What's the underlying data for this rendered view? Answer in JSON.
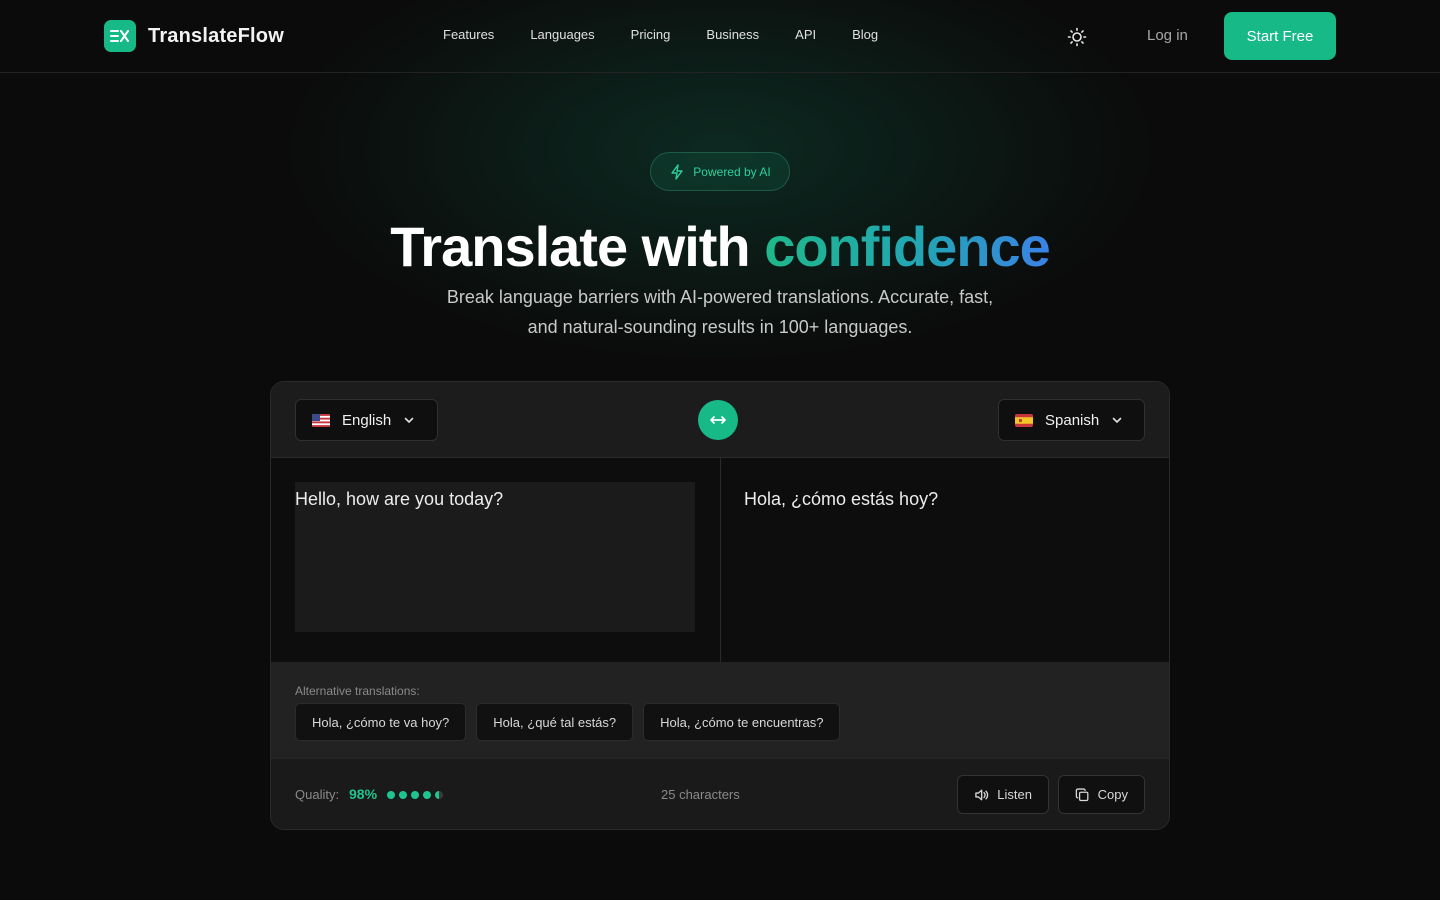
{
  "nav": {
    "brand": "TranslateFlow",
    "logo_icon": "translate-logo-icon",
    "links": [
      "Features",
      "Languages",
      "Pricing",
      "Business",
      "API",
      "Blog"
    ],
    "theme_icon": "sun-icon",
    "login_label": "Log in",
    "cta_label": "Start Free"
  },
  "hero": {
    "badge_icon": "lightning-icon",
    "badge_label": "Powered by AI",
    "title_main": "Translate with ",
    "title_accent": "confidence",
    "subtitle_line1": "Break language barriers with AI-powered translations. Accurate, fast,",
    "subtitle_line2": "and natural-sounding results in 100+ languages."
  },
  "translator": {
    "source_language": "English",
    "target_language": "Spanish",
    "swap_icon": "swap-arrows-icon",
    "source_text": "Hello, how are you today?",
    "target_text": "Hola, ¿cómo estás hoy?",
    "alternatives_label": "Alternative translations:",
    "alternatives": [
      "Hola, ¿cómo te va hoy?",
      "Hola, ¿qué tal estás?",
      "Hola, ¿cómo te encuentras?"
    ],
    "quality_label": "Quality:",
    "quality_value": "98%",
    "quality_rating": 4.5,
    "quality_max": 5,
    "char_count": "25 characters",
    "listen_label": "Listen",
    "copy_label": "Copy"
  },
  "colors": {
    "accent": "#17b987",
    "background": "#0b0b0b",
    "gradient_start": "#1fb88a",
    "gradient_end": "#3b82e6"
  }
}
